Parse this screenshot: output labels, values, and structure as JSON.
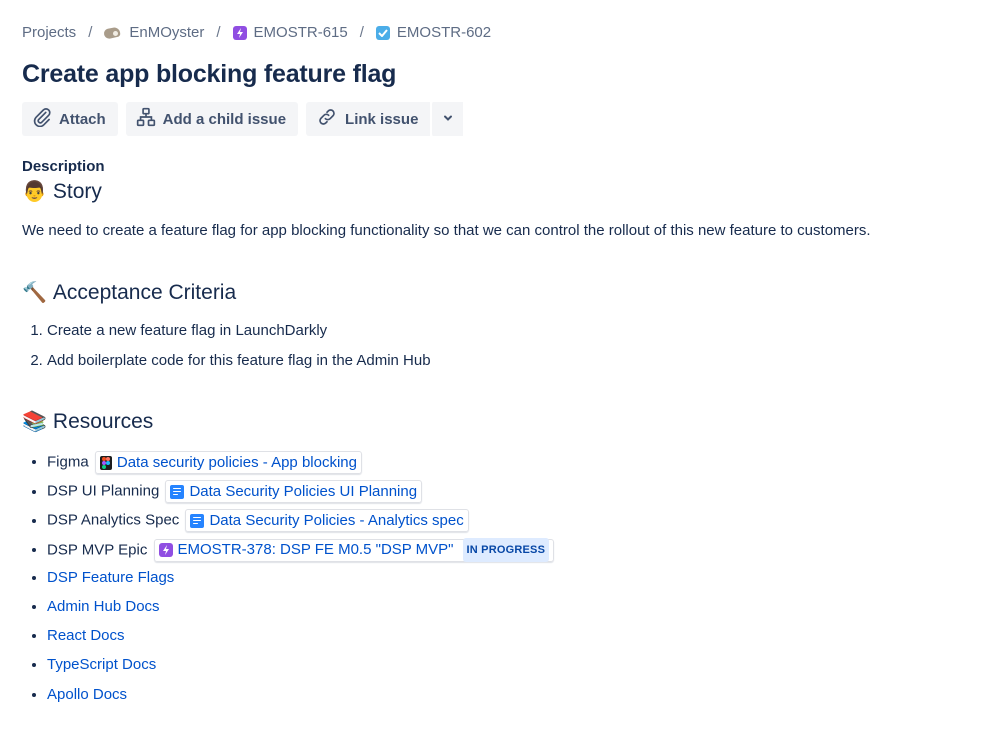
{
  "breadcrumb": {
    "projects": "Projects",
    "project_name": "EnMOyster",
    "epic_key": "EMOSTR-615",
    "issue_key": "EMOSTR-602",
    "separator": "/"
  },
  "title": "Create app blocking feature flag",
  "toolbar": {
    "attach": "Attach",
    "add_child": "Add a child issue",
    "link_issue": "Link issue"
  },
  "description_label": "Description",
  "story": {
    "emoji": "👨",
    "heading": "Story",
    "text": "We need to create a feature flag for app blocking functionality so that we can control the rollout of this new feature to customers."
  },
  "acceptance": {
    "emoji": "🔨",
    "heading": "Acceptance Criteria",
    "items": [
      "Create a new feature flag in LaunchDarkly",
      "Add boilerplate code for this feature flag in the Admin Hub"
    ]
  },
  "resources": {
    "emoji": "📚",
    "heading": "Resources",
    "items": [
      {
        "label": "Figma",
        "link": "Data security policies - App blocking"
      },
      {
        "label": "DSP UI Planning",
        "link": "Data Security Policies UI Planning"
      },
      {
        "label": "DSP Analytics Spec",
        "link": "Data Security Policies - Analytics spec"
      },
      {
        "label": "DSP MVP Epic",
        "link": "EMOSTR-378: DSP FE M0.5 \"DSP MVP\"",
        "status": "IN PROGRESS"
      }
    ],
    "links": [
      "DSP Feature Flags",
      "Admin Hub Docs",
      "React Docs",
      "TypeScript Docs",
      "Apollo Docs"
    ]
  },
  "colors": {
    "text": "#172b4d",
    "link": "#0052cc",
    "button_bg": "#f4f5f7",
    "epic": "#904ee2",
    "task": "#4bade8",
    "badge_bg": "#deebff"
  }
}
